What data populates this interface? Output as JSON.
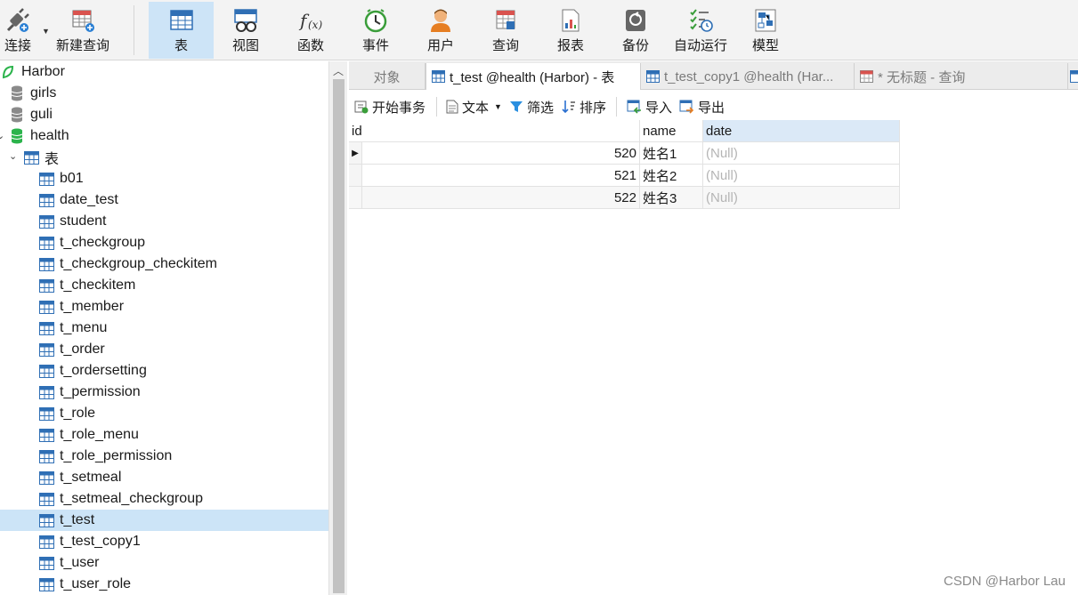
{
  "toolbar": {
    "buttons": [
      {
        "label": "连接",
        "icon": "plug-icon"
      },
      {
        "label": "新建查询",
        "icon": "new-query-icon"
      },
      {
        "label": "表",
        "icon": "table-icon",
        "active": true
      },
      {
        "label": "视图",
        "icon": "view-icon"
      },
      {
        "label": "函数",
        "icon": "function-icon"
      },
      {
        "label": "事件",
        "icon": "clock-icon"
      },
      {
        "label": "用户",
        "icon": "user-icon"
      },
      {
        "label": "查询",
        "icon": "query-icon"
      },
      {
        "label": "报表",
        "icon": "report-icon"
      },
      {
        "label": "备份",
        "icon": "backup-icon"
      },
      {
        "label": "自动运行",
        "icon": "schedule-icon"
      },
      {
        "label": "模型",
        "icon": "model-icon"
      }
    ]
  },
  "tree": {
    "connection": "Harbor",
    "databases": [
      "girls",
      "guli",
      "health"
    ],
    "tables_group": "表",
    "tables": [
      "b01",
      "date_test",
      "student",
      "t_checkgroup",
      "t_checkgroup_checkitem",
      "t_checkitem",
      "t_member",
      "t_menu",
      "t_order",
      "t_ordersetting",
      "t_permission",
      "t_role",
      "t_role_menu",
      "t_role_permission",
      "t_setmeal",
      "t_setmeal_checkgroup",
      "t_test",
      "t_test_copy1",
      "t_user",
      "t_user_role"
    ],
    "selected_table": "t_test"
  },
  "tabs": [
    {
      "label": "对象"
    },
    {
      "label": "t_test @health (Harbor) - 表",
      "active": true
    },
    {
      "label": "t_test_copy1 @health (Har..."
    },
    {
      "label": "* 无标题 - 查询"
    }
  ],
  "subtoolbar": {
    "begin_tx": "开始事务",
    "text": "文本",
    "filter": "筛选",
    "sort": "排序",
    "import": "导入",
    "export": "导出"
  },
  "grid": {
    "columns": [
      "id",
      "name",
      "date"
    ],
    "rows": [
      {
        "id": "520",
        "name": "姓名1",
        "date": "(Null)"
      },
      {
        "id": "521",
        "name": "姓名2",
        "date": "(Null)"
      },
      {
        "id": "522",
        "name": "姓名3",
        "date": "(Null)"
      }
    ]
  },
  "watermark": "CSDN @Harbor Lau",
  "colors": {
    "accent": "#cde4f7",
    "db_active": "#2bb34b",
    "table_icon": "#2f6fb5"
  }
}
